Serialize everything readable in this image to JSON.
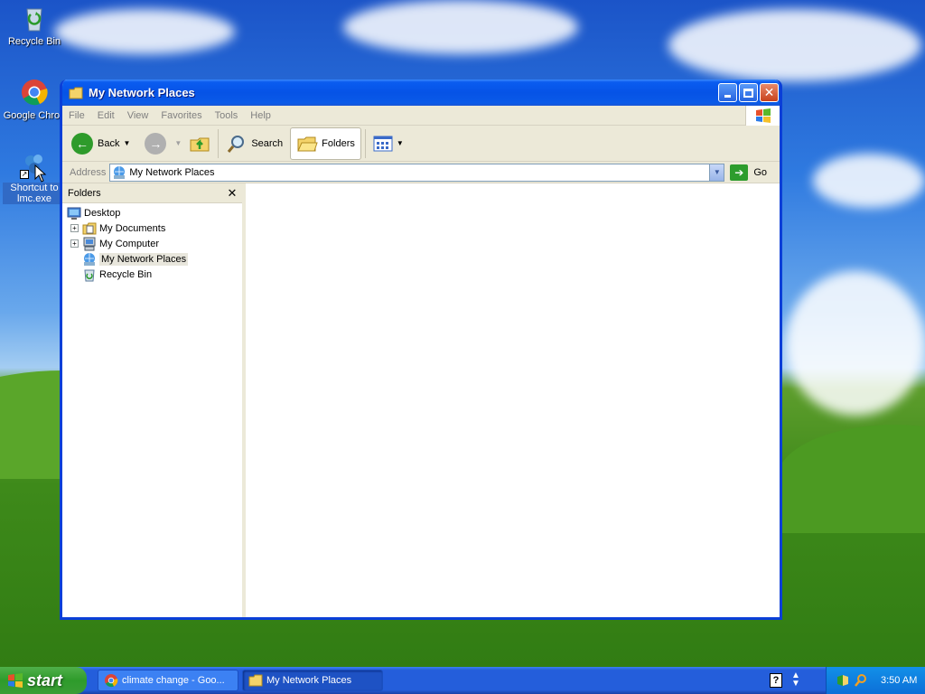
{
  "desktop": {
    "icons": [
      {
        "label": "Recycle Bin",
        "icon": "recycle-bin-icon"
      },
      {
        "label": "Google Chron",
        "icon": "chrome-icon"
      },
      {
        "label": "Shortcut to lmc.exe",
        "icon": "network-shortcut-icon"
      }
    ]
  },
  "window": {
    "title": "My Network Places",
    "menu": [
      "File",
      "Edit",
      "View",
      "Favorites",
      "Tools",
      "Help"
    ],
    "toolbar": {
      "back_label": "Back",
      "search_label": "Search",
      "folders_label": "Folders"
    },
    "address": {
      "label": "Address",
      "value": "My Network Places",
      "go_label": "Go"
    },
    "folders_pane": {
      "title": "Folders",
      "tree": [
        {
          "label": "Desktop",
          "icon": "desktop-icon",
          "level": 0
        },
        {
          "label": "My Documents",
          "icon": "my-documents-icon",
          "level": 1,
          "expandable": true
        },
        {
          "label": "My Computer",
          "icon": "my-computer-icon",
          "level": 1,
          "expandable": true
        },
        {
          "label": "My Network Places",
          "icon": "network-places-icon",
          "level": 1,
          "selected": true
        },
        {
          "label": "Recycle Bin",
          "icon": "recycle-bin-icon",
          "level": 1
        }
      ]
    }
  },
  "taskbar": {
    "start_label": "start",
    "tasks": [
      {
        "label": "climate change - Goo...",
        "icon": "chrome-icon"
      },
      {
        "label": "My Network Places",
        "icon": "folder-icon",
        "active": true
      }
    ],
    "clock": "3:50 AM"
  },
  "colors": {
    "titlebar": "#0653e6",
    "taskbar": "#245edb",
    "start": "#2e9b2b",
    "selection": "#316ac5"
  }
}
